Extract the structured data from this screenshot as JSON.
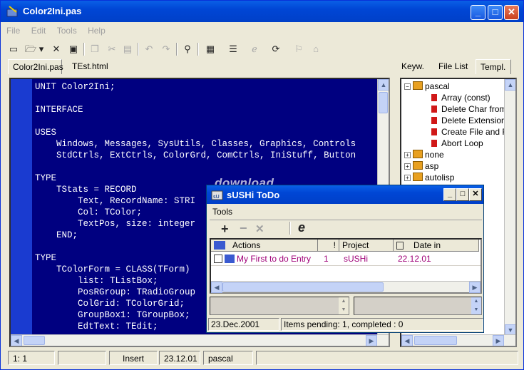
{
  "window": {
    "title": "Color2Ini.pas"
  },
  "menu": [
    "File",
    "Edit",
    "Tools",
    "Help"
  ],
  "tabs_left": [
    "Color2Ini.pas",
    "TEst.html"
  ],
  "tabs_right": [
    "Keyw.",
    "File List",
    "Templ."
  ],
  "code_lines": [
    "UNIT Color2Ini;",
    "",
    "INTERFACE",
    "",
    "USES",
    "    Windows, Messages, SysUtils, Classes, Graphics, Controls",
    "    StdCtrls, ExtCtrls, ColorGrd, ComCtrls, IniStuff, Button",
    "",
    "TYPE",
    "    TStats = RECORD",
    "        Text, RecordName: STRI",
    "        Col: TColor;",
    "        TextPos, size: integer",
    "    END;",
    "",
    "TYPE",
    "    TColorForm = CLASS(TForm)",
    "        list: TListBox;",
    "        PosRGroup: TRadioGroup",
    "        ColGrid: TColorGrid;",
    "        GroupBox1: TGroupBox;",
    "        EdtText: TEdit;"
  ],
  "tree": {
    "root": "pascal",
    "children": [
      "Array (const)",
      "Delete Char from S",
      "Delete Extension",
      "Create File and Fo",
      "Abort Loop"
    ],
    "others": [
      "none",
      "asp",
      "autolisp"
    ]
  },
  "status": {
    "pos": "1:  1",
    "mode": "Insert",
    "date": "23.12.01",
    "lang": "pascal"
  },
  "todo": {
    "title": "sUSHi ToDo",
    "menu": "Tools",
    "columns": [
      "Actions",
      "!",
      "Project",
      "Date in"
    ],
    "rows": [
      {
        "action": "My First to do Entry",
        "priority": "1",
        "project": "sUSHi",
        "date": "22.12.01"
      }
    ],
    "status_date": "23.Dec.2001",
    "status_items": "Items pending: 1, completed : 0"
  },
  "watermark": "download",
  "colors": {
    "editor_bg": "#000080",
    "titlebar": "#0046d5",
    "entry_text": "#a00078"
  }
}
